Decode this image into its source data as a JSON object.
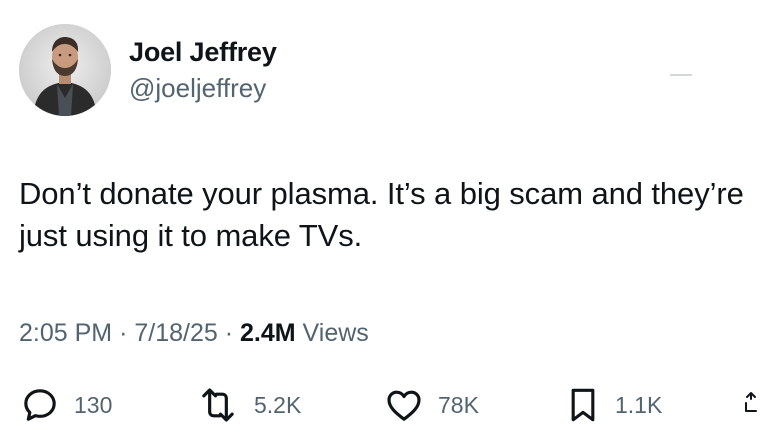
{
  "author": {
    "display_name": "Joel Jeffrey",
    "handle": "@joeljeffrey"
  },
  "tweet": {
    "text": "Don’t donate your plasma. It’s a big scam and they’re just using it to make TVs."
  },
  "meta": {
    "time": "2:05 PM",
    "sep1": "·",
    "date": "7/18/25",
    "sep2": "·",
    "views_count": "2.4M",
    "views_label": "Views"
  },
  "actions": {
    "reply_count": "130",
    "repost_count": "5.2K",
    "like_count": "78K",
    "bookmark_count": "1.1K"
  },
  "icons": {
    "reply": "reply-icon",
    "repost": "repost-icon",
    "like": "heart-icon",
    "bookmark": "bookmark-icon",
    "share": "share-icon"
  },
  "colors": {
    "text": "#0f1419",
    "secondary": "#536471"
  }
}
